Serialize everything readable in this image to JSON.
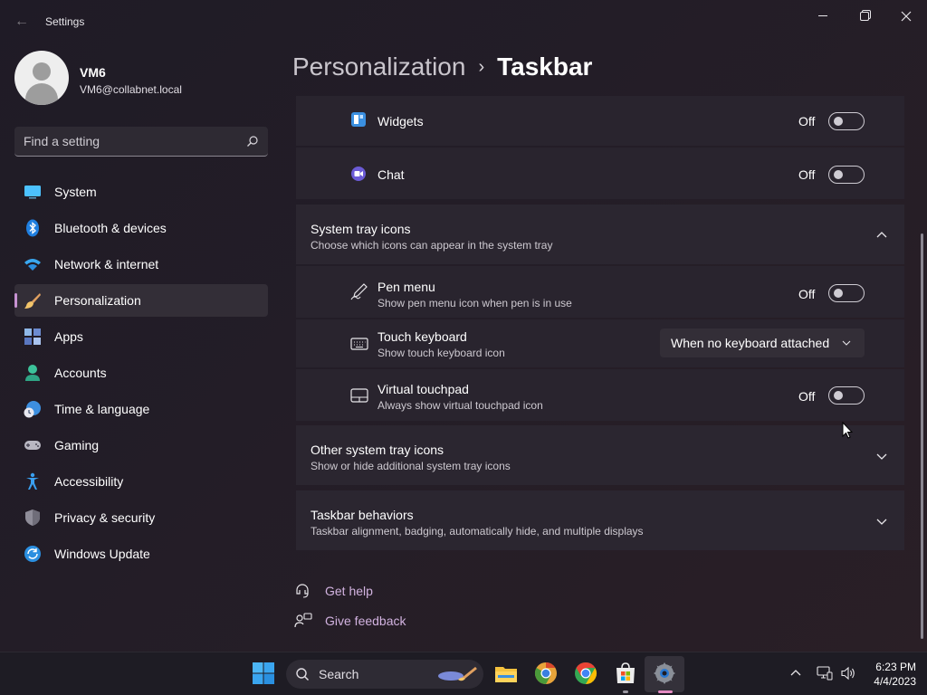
{
  "window": {
    "title": "Settings"
  },
  "profile": {
    "name": "VM6",
    "email": "VM6@collabnet.local"
  },
  "search": {
    "placeholder": "Find a setting"
  },
  "sidebar": {
    "items": [
      {
        "label": "System",
        "icon": "monitor-icon"
      },
      {
        "label": "Bluetooth & devices",
        "icon": "bluetooth-icon"
      },
      {
        "label": "Network & internet",
        "icon": "wifi-icon"
      },
      {
        "label": "Personalization",
        "icon": "brush-icon",
        "active": true
      },
      {
        "label": "Apps",
        "icon": "apps-icon"
      },
      {
        "label": "Accounts",
        "icon": "person-icon"
      },
      {
        "label": "Time & language",
        "icon": "globe-clock-icon"
      },
      {
        "label": "Gaming",
        "icon": "gamepad-icon"
      },
      {
        "label": "Accessibility",
        "icon": "accessibility-icon"
      },
      {
        "label": "Privacy & security",
        "icon": "shield-icon"
      },
      {
        "label": "Windows Update",
        "icon": "update-icon"
      }
    ]
  },
  "breadcrumb": {
    "parent": "Personalization",
    "separator": "›",
    "current": "Taskbar"
  },
  "taskbar_items": {
    "widgets": {
      "label": "Widgets",
      "state": "Off"
    },
    "chat": {
      "label": "Chat",
      "state": "Off"
    }
  },
  "system_tray": {
    "title": "System tray icons",
    "subtitle": "Choose which icons can appear in the system tray",
    "pen_menu": {
      "label": "Pen menu",
      "description": "Show pen menu icon when pen is in use",
      "state": "Off"
    },
    "touch_keyboard": {
      "label": "Touch keyboard",
      "description": "Show touch keyboard icon",
      "value": "When no keyboard attached"
    },
    "virtual_touchpad": {
      "label": "Virtual touchpad",
      "description": "Always show virtual touchpad icon",
      "state": "Off"
    }
  },
  "other_tray": {
    "title": "Other system tray icons",
    "subtitle": "Show or hide additional system tray icons"
  },
  "behaviors": {
    "title": "Taskbar behaviors",
    "subtitle": "Taskbar alignment, badging, automatically hide, and multiple displays"
  },
  "help": {
    "get_help": "Get help",
    "give_feedback": "Give feedback"
  },
  "os_taskbar": {
    "search_label": "Search",
    "time": "6:23 PM",
    "date": "4/4/2023"
  },
  "colors": {
    "accent": "#c792d2",
    "link": "#d2b3e0",
    "card": "#2b2630"
  }
}
